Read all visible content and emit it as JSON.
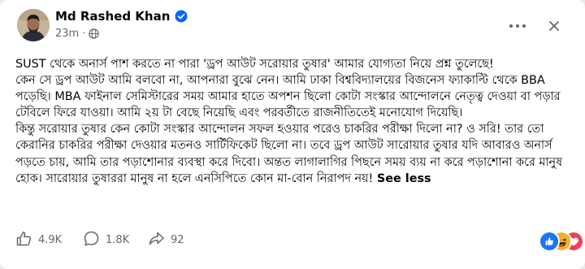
{
  "post": {
    "author_name": "Md Rashed Khan",
    "timestamp": "23m",
    "separator": "·",
    "body": "SUST থেকে অনার্স পাশ করতে না পারা 'ড্রপ আউট  সরোয়ার তুষার' আমার যোগ্যতা নিয়ে প্রশ্ন তুলেছে!\nকেন সে ড্রপ আউট আমি বলবো না, আপনারা বুঝে নেন। আমি ঢাকা বিশ্ববিদ্যালয়ের বিজনেস ফ্যাকাল্টি থেকে BBA পড়েছি। MBA ফাইনাল সেমিস্টারের সময় আমার হাতে অপশন ছিলো কোটা সংস্কার আন্দোলনে নেতৃত্ব দেওয়া বা পড়ার টেবিলে ফিরে যাওয়া। আমি ২য় টা বেছে নিয়েছি এবং পরবর্তীতে রাজনীতিতেই মনোযোগ দিয়েছি।\nকিন্তু সরোয়ার তুষার কেন কোটা সংস্কার আন্দোলন সফল হওয়ার পরেও চাকরির পরীক্ষা দিলো না? ও সরি! তার তো কেরানির চাকরির পরীক্ষা দেওয়ার মতনও সার্টিফিকেট ছিলো না। তবে ড্রপ আউট সারোয়ার তুষার যদি আবারও অনার্স পড়তে চায়, আমি তার পড়াশোনার ব্যবস্থা করে দিবো। অন্তত লাগালাগির পিছনে সময় ব্যয় না করে পড়াশোনা করে মানুষ হোক। সারোয়ার তুষাররা মানুষ না হলে এনসিপিতে কোন মা-বোন নিরাপদ নয়! ",
    "see_less": "See less"
  },
  "stats": {
    "likes": "4.9K",
    "comments": "1.8K",
    "shares": "92"
  },
  "icons": {
    "verified": "verified-badge-icon",
    "audience": "globe-icon",
    "more": "more-options-icon",
    "close": "close-icon",
    "like": "like-icon",
    "comment": "comment-icon",
    "share": "share-icon"
  },
  "colors": {
    "verified_blue": "#0866ff",
    "secondary_text": "#65676b",
    "like_blue": "#1877f2",
    "haha_yellow": "#f7b125",
    "love_red": "#f33e58"
  }
}
